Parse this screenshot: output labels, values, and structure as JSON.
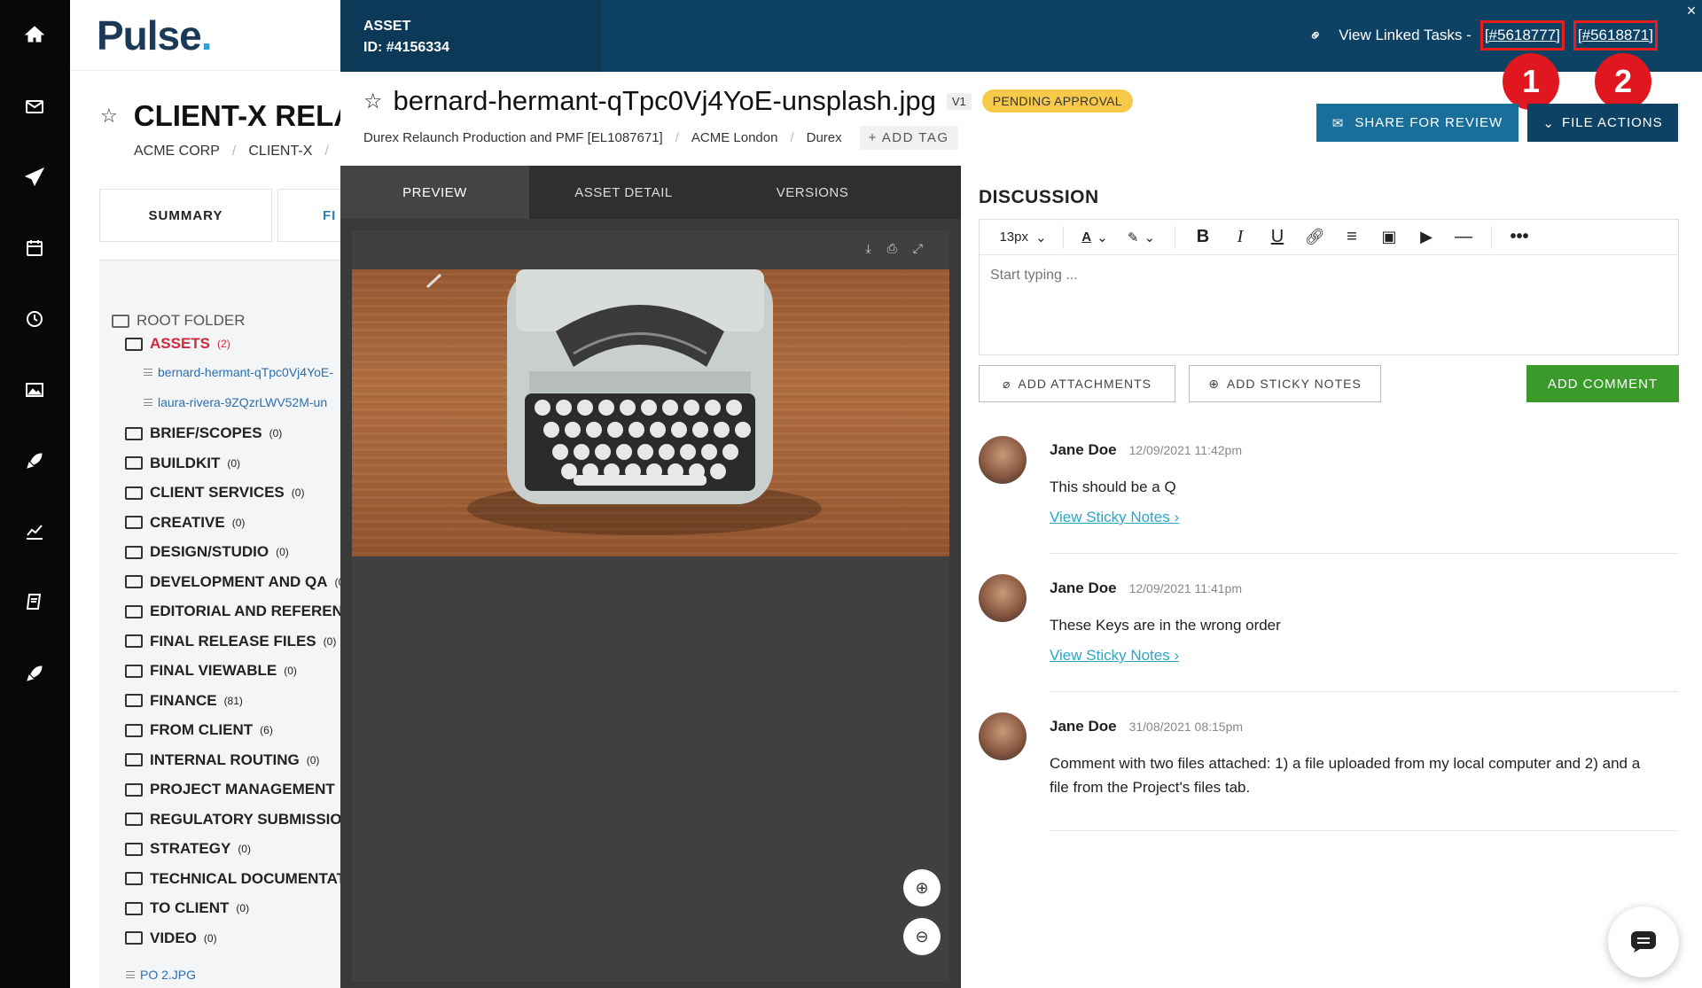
{
  "rail": {
    "icons": [
      "home-icon",
      "mail-icon",
      "send-icon",
      "calendar-icon",
      "clock-icon",
      "image-icon",
      "rocket-icon",
      "chart-icon",
      "book-icon",
      "rocket-icon-2"
    ]
  },
  "project": {
    "logo_text": "Pulse",
    "title": "CLIENT-X RELAU",
    "crumbs": [
      "ACME CORP",
      "CLIENT-X"
    ],
    "tabs": [
      "SUMMARY",
      "FI"
    ],
    "tree": {
      "root": "ROOT FOLDER",
      "assets": {
        "label": "ASSETS",
        "count": "(2)"
      },
      "files": [
        "bernard-hermant-qTpc0Vj4YoE-",
        "laura-rivera-9ZQzrLWV52M-un"
      ],
      "folders": [
        {
          "label": "BRIEF/SCOPES",
          "count": "(0)"
        },
        {
          "label": "BUILDKIT",
          "count": "(0)"
        },
        {
          "label": "CLIENT SERVICES",
          "count": "(0)"
        },
        {
          "label": "CREATIVE",
          "count": "(0)"
        },
        {
          "label": "DESIGN/STUDIO",
          "count": "(0)"
        },
        {
          "label": "DEVELOPMENT AND QA",
          "count": "(0"
        },
        {
          "label": "EDITORIAL AND REFEREN",
          "count": ""
        },
        {
          "label": "FINAL RELEASE FILES",
          "count": "(0)"
        },
        {
          "label": "FINAL VIEWABLE",
          "count": "(0)"
        },
        {
          "label": "FINANCE",
          "count": "(81)"
        },
        {
          "label": "FROM CLIENT",
          "count": "(6)"
        },
        {
          "label": "INTERNAL ROUTING",
          "count": "(0)"
        },
        {
          "label": "PROJECT MANAGEMENT",
          "count": "("
        },
        {
          "label": "REGULATORY SUBMISSIO",
          "count": ""
        },
        {
          "label": "STRATEGY",
          "count": "(0)"
        },
        {
          "label": "TECHNICAL DOCUMENTAT",
          "count": ""
        },
        {
          "label": "TO CLIENT",
          "count": "(0)"
        },
        {
          "label": "VIDEO",
          "count": "(0)"
        }
      ],
      "bottom_file": "PO 2.JPG"
    }
  },
  "asset": {
    "header_label": "ASSET",
    "id_label": "ID: #4156334",
    "view_linked_label": "View Linked Tasks -",
    "linked_tasks": [
      "[#5618777]",
      "[#5618871]"
    ],
    "annotation_markers": [
      "1",
      "2"
    ],
    "close_label": "×",
    "name": "bernard-hermant-qTpc0Vj4YoE-unsplash.jpg",
    "version": "V1",
    "status": "PENDING APPROVAL",
    "status_color": "#f7c948",
    "crumbs": [
      "Durex Relaunch Production and PMF [EL1087671]",
      "ACME London",
      "Durex"
    ],
    "add_tag": "+ ADD TAG",
    "share_button": "SHARE FOR REVIEW",
    "file_actions_button": "FILE ACTIONS"
  },
  "preview": {
    "tabs": [
      "PREVIEW",
      "ASSET DETAIL",
      "VERSIONS"
    ],
    "active_tab": "PREVIEW",
    "tools": [
      "download-icon",
      "print-icon",
      "expand-icon"
    ]
  },
  "discussion": {
    "title": "DISCUSSION",
    "font_size": "13px",
    "placeholder": "Start typing ...",
    "add_attachments": "ADD ATTACHMENTS",
    "add_sticky_notes": "ADD STICKY NOTES",
    "add_comment": "ADD COMMENT",
    "comments": [
      {
        "author": "Jane Doe",
        "date": "12/09/2021 11:42pm",
        "text": "This should be a Q",
        "link": "View Sticky Notes ›"
      },
      {
        "author": "Jane Doe",
        "date": "12/09/2021 11:41pm",
        "text": "These Keys are in the wrong order",
        "link": "View Sticky Notes ›"
      },
      {
        "author": "Jane Doe",
        "date": "31/08/2021 08:15pm",
        "text": "Comment with two files attached: 1) a file uploaded from my local computer and 2) and a file from the Project's files tab.",
        "link": ""
      }
    ]
  }
}
